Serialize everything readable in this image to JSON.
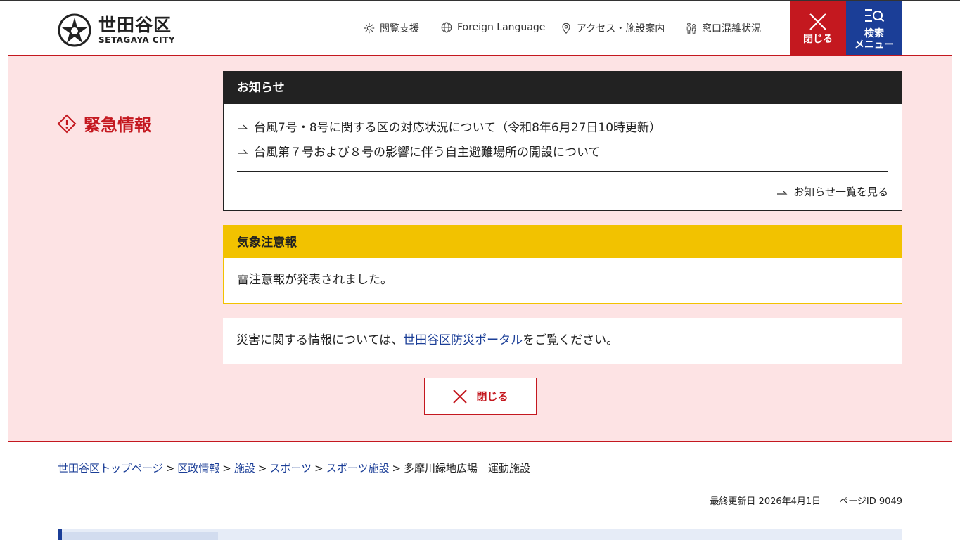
{
  "header": {
    "logo_jp": "世田谷区",
    "logo_en": "SETAGAYA CITY",
    "util_nav": [
      {
        "label": "閲覧支援",
        "icon": "gear-icon"
      },
      {
        "label": "Foreign Language",
        "icon": "globe-icon"
      },
      {
        "label": "アクセス・施設案内",
        "icon": "map-pin-icon"
      },
      {
        "label": "窓口混雑状況",
        "icon": "people-icon"
      }
    ],
    "close_label": "閉じる",
    "menu_label_1": "検索",
    "menu_label_2": "メニュー"
  },
  "emergency": {
    "heading": "緊急情報",
    "notice": {
      "title": "お知らせ",
      "items": [
        "台風7号・8号に関する区の対応状況について（令和8年6月27日10時更新）",
        "台風第７号および８号の影響に伴う自主避難場所の開設について"
      ],
      "more_label": "お知らせ一覧を見る"
    },
    "weather": {
      "title": "気象注意報",
      "body": "雷注意報が発表されました。"
    },
    "portal": {
      "prefix": "災害に関する情報については、",
      "link": "世田谷区防災ポータル",
      "suffix": "をご覧ください。"
    },
    "close_label": "閉じる"
  },
  "breadcrumb": {
    "links": [
      "世田谷区トップページ",
      "区政情報",
      "施設",
      "スポーツ",
      "スポーツ施設"
    ],
    "separator": ">",
    "current": "多摩川緑地広場　運動施設"
  },
  "meta": {
    "last_updated": "最終更新日 2026年4月1日",
    "page_id": "ページID 9049"
  },
  "colors": {
    "brand_red": "#c4181f",
    "brand_blue": "#1b3e97",
    "warning_yellow": "#f2c200",
    "emergency_bg": "#fde3e4"
  }
}
